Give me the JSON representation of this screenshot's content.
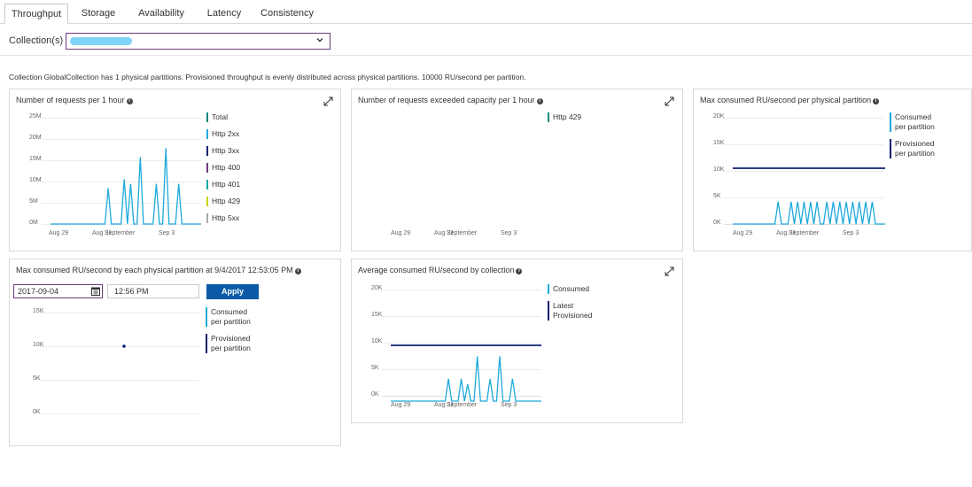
{
  "tabs": [
    {
      "label": "Throughput"
    },
    {
      "label": "Storage"
    },
    {
      "label": "Availability"
    },
    {
      "label": "Latency"
    },
    {
      "label": "Consistency"
    }
  ],
  "collection": {
    "label": "Collection(s)",
    "selected": ""
  },
  "info": "Collection GlobalCollection has 1 physical partitions. Provisioned throughput is evenly distributed across physical partitions. 10000 RU/second per partition.",
  "colors": {
    "consumed": "#1ea9dc",
    "provisioned": "#0d2070",
    "apply": "#0a5aa8",
    "accent": "#6b3a7a"
  },
  "panels": {
    "requests": {
      "title": "Number of requests per 1 hour",
      "y_ticks": [
        "25M",
        "20M",
        "15M",
        "10M",
        "5M",
        "0M"
      ],
      "x_ticks": [
        "Aug 29",
        "Aug 31",
        "September",
        "Sep 3"
      ],
      "legend": [
        {
          "label": "Total",
          "color": "#0a8a7e"
        },
        {
          "label": "Http 2xx",
          "color": "#1ea9dc"
        },
        {
          "label": "Http 3xx",
          "color": "#0d2070"
        },
        {
          "label": "Http 400",
          "color": "#6b3a7a"
        },
        {
          "label": "Http 401",
          "color": "#0aa89e"
        },
        {
          "label": "Http 429",
          "color": "#c9d400"
        },
        {
          "label": "Http 5xx",
          "color": "#aaaaaa"
        }
      ]
    },
    "exceeded": {
      "title": "Number of requests exceeded capacity per 1 hour",
      "x_ticks": [
        "Aug 29",
        "Aug 31",
        "September",
        "Sep 3"
      ],
      "legend": [
        {
          "label": "Http 429",
          "color": "#0a8a7e"
        }
      ]
    },
    "max_partition": {
      "title": "Max consumed RU/second per physical partition",
      "y_ticks": [
        "20K",
        "15K",
        "10K",
        "5K",
        "0K"
      ],
      "x_ticks": [
        "Aug 29",
        "Aug 31",
        "September",
        "Sep 3"
      ],
      "legend": [
        {
          "label": "Consumed per partition",
          "color": "#1ea9dc"
        },
        {
          "label": "Provisioned per partition",
          "color": "#0d2070"
        }
      ]
    },
    "each_partition": {
      "title": "Max consumed RU/second by each physical partition at 9/4/2017 12:53:05 PM",
      "date_value": "2017-09-04",
      "time_value": "12:56 PM",
      "apply_label": "Apply",
      "y_ticks": [
        "15K",
        "10K",
        "5K",
        "0K"
      ],
      "legend": [
        {
          "label": "Consumed per partition",
          "color": "#1ea9dc"
        },
        {
          "label": "Provisioned per partition",
          "color": "#0d2070"
        }
      ]
    },
    "avg_collection": {
      "title": "Average consumed RU/second by collection",
      "y_ticks": [
        "20K",
        "15K",
        "10K",
        "5K",
        "0K"
      ],
      "x_ticks": [
        "Aug 29",
        "Aug 31",
        "September",
        "Sep 3"
      ],
      "legend": [
        {
          "label": "Consumed",
          "color": "#1ea9dc"
        },
        {
          "label": "Latest Provisioned",
          "color": "#0d2070"
        }
      ]
    }
  },
  "chart_data": [
    {
      "type": "line",
      "title": "Number of requests per 1 hour",
      "ylim": [
        0,
        25000000
      ],
      "x": [
        "Aug 29",
        "Aug 31",
        "September",
        "Sep 3"
      ],
      "series": [
        {
          "name": "Http 2xx",
          "values": [
            0,
            0,
            0,
            0,
            0,
            0,
            0,
            0,
            0,
            0,
            0,
            0,
            0,
            0,
            0,
            0,
            0,
            0,
            8000000,
            0,
            0,
            0,
            0,
            10000000,
            0,
            9000000,
            0,
            0,
            15000000,
            0,
            0,
            0,
            0,
            9000000,
            0,
            0,
            17000000,
            0,
            0,
            0,
            9000000,
            0,
            0,
            0,
            0,
            0,
            0,
            0
          ]
        }
      ]
    },
    {
      "type": "line",
      "title": "Number of requests exceeded capacity per 1 hour",
      "series": [
        {
          "name": "Http 429",
          "values": []
        }
      ]
    },
    {
      "type": "line",
      "title": "Max consumed RU/second per physical partition",
      "ylim": [
        0,
        20000
      ],
      "x": [
        "Aug 29",
        "Aug 31",
        "September",
        "Sep 3"
      ],
      "series": [
        {
          "name": "Consumed per partition",
          "values": [
            0,
            0,
            0,
            0,
            0,
            0,
            0,
            0,
            0,
            0,
            0,
            0,
            0,
            0,
            4000,
            0,
            0,
            0,
            4000,
            0,
            4000,
            0,
            4000,
            0,
            4000,
            0,
            4000,
            0,
            0,
            4000,
            0,
            4000,
            0,
            4000,
            0,
            4000,
            0,
            4000,
            0,
            4000,
            0,
            4000,
            0,
            4000,
            0,
            0,
            0,
            0
          ]
        },
        {
          "name": "Provisioned per partition",
          "values": [
            10000,
            10000
          ]
        }
      ]
    },
    {
      "type": "scatter",
      "title": "Max consumed RU/second by each physical partition at 9/4/2017 12:53:05 PM",
      "ylim": [
        0,
        15000
      ],
      "series": [
        {
          "name": "Provisioned per partition",
          "values": [
            10000
          ]
        }
      ]
    },
    {
      "type": "line",
      "title": "Average consumed RU/second by collection",
      "ylim": [
        0,
        20000
      ],
      "x": [
        "Aug 29",
        "Aug 31",
        "September",
        "Sep 3"
      ],
      "series": [
        {
          "name": "Consumed",
          "values": [
            0,
            0,
            0,
            0,
            0,
            0,
            0,
            0,
            0,
            0,
            0,
            0,
            0,
            0,
            0,
            0,
            0,
            0,
            4000,
            0,
            0,
            0,
            4000,
            0,
            3000,
            0,
            0,
            8000,
            0,
            0,
            0,
            4000,
            0,
            0,
            8000,
            0,
            0,
            0,
            4000,
            0,
            0,
            0,
            0,
            0,
            0,
            0,
            0,
            0
          ]
        },
        {
          "name": "Latest Provisioned",
          "values": [
            10000,
            10000
          ]
        }
      ]
    }
  ]
}
